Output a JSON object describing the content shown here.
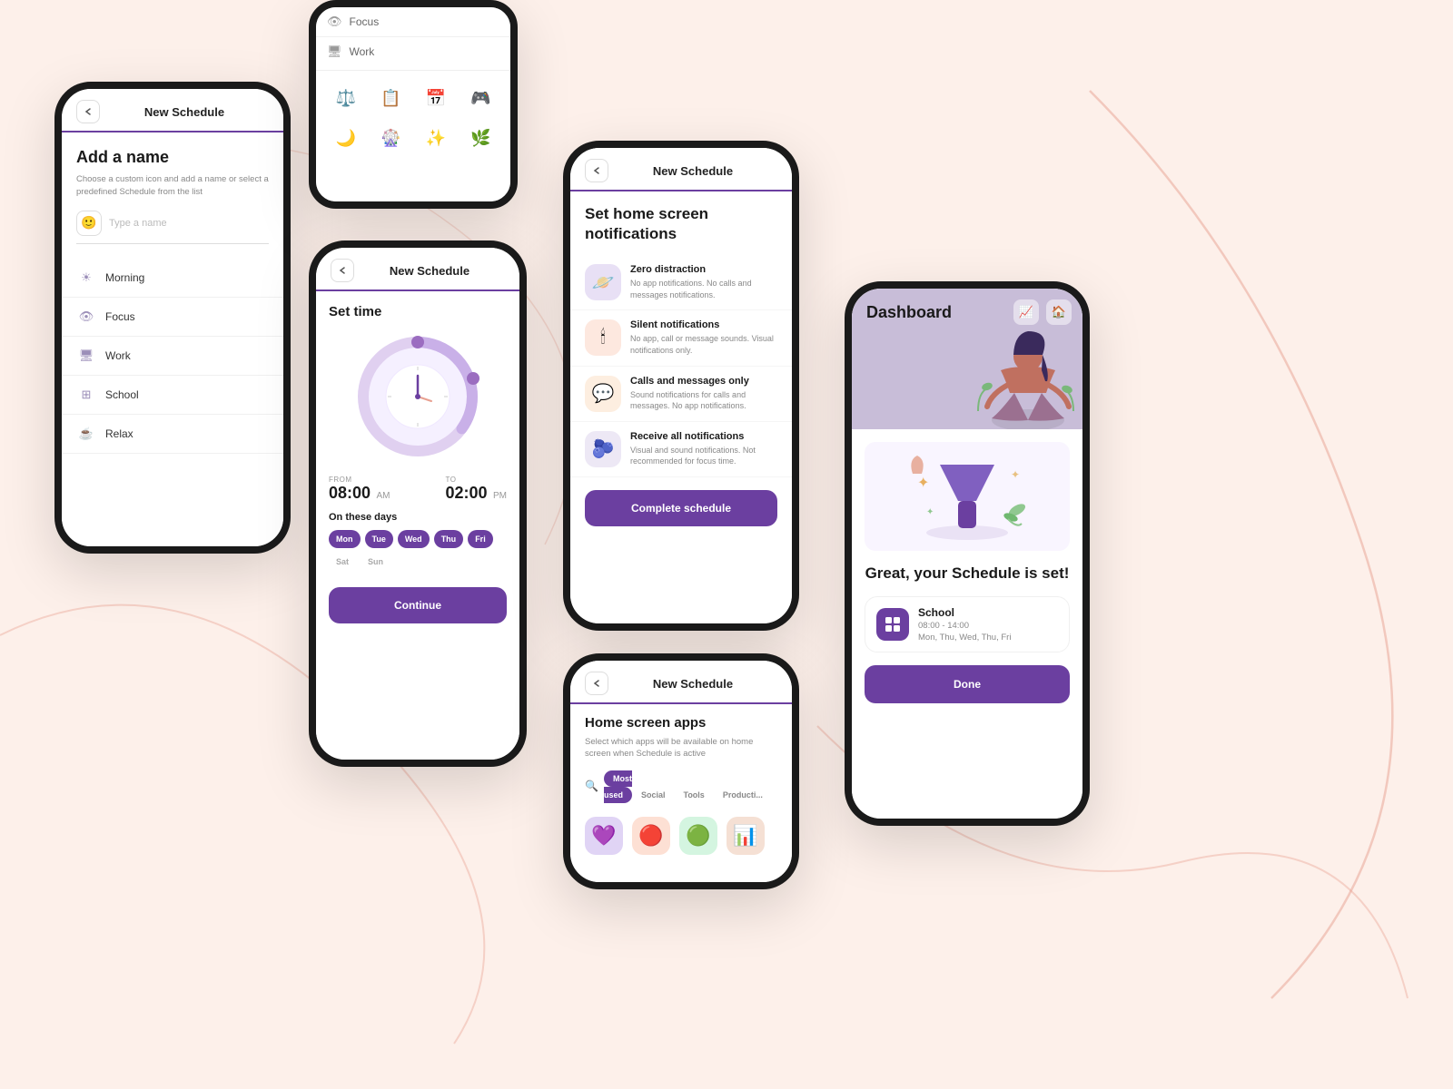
{
  "bg": {
    "color": "#fdf0ea"
  },
  "phone1": {
    "header": {
      "back": "‹",
      "title": "New Schedule"
    },
    "add_name": {
      "title": "Add a name",
      "subtitle": "Choose a custom icon and add a name or select a predefined Schedule from the list",
      "input_placeholder": "Type a name"
    },
    "list": [
      {
        "icon": "☀",
        "label": "Morning"
      },
      {
        "icon": "👁",
        "label": "Focus"
      },
      {
        "icon": "🖥",
        "label": "Work"
      },
      {
        "icon": "⊞",
        "label": "School"
      },
      {
        "icon": "☕",
        "label": "Relax"
      }
    ]
  },
  "phone2": {
    "items": [
      {
        "label": "Focus"
      },
      {
        "label": "Work"
      }
    ],
    "icons": [
      "⚖",
      "📋",
      "📅",
      "🎮",
      "🌙",
      "🎡",
      "✨",
      "🌿"
    ]
  },
  "phone3": {
    "header": {
      "title": "New Schedule"
    },
    "set_time": {
      "title": "Set time",
      "from_label": "FROM",
      "from_time": "08:00",
      "from_ampm": "AM",
      "to_label": "TO",
      "to_time": "02:00",
      "to_ampm": "PM"
    },
    "days": {
      "title": "On these days",
      "list": [
        {
          "label": "Mon",
          "active": true
        },
        {
          "label": "Tue",
          "active": true
        },
        {
          "label": "Wed",
          "active": true
        },
        {
          "label": "Thu",
          "active": true
        },
        {
          "label": "Fri",
          "active": true
        },
        {
          "label": "Sat",
          "active": false
        },
        {
          "label": "Sun",
          "active": false
        }
      ]
    },
    "continue_btn": "Continue"
  },
  "phone4": {
    "header": {
      "title": "New Schedule"
    },
    "title": "Set home screen notifications",
    "notifications": [
      {
        "title": "Zero distraction",
        "subtitle": "No app notifications. No calls and messages notifications.",
        "icon": "🪐",
        "color": "purple"
      },
      {
        "title": "Silent notifications",
        "subtitle": "No app, call or message sounds. Visual notifications only.",
        "icon": "🕯",
        "color": "peach"
      },
      {
        "title": "Calls and messages only",
        "subtitle": "Sound notifications for calls and messages. No app notifications.",
        "icon": "💬",
        "color": "orange"
      },
      {
        "title": "Receive all notifications",
        "subtitle": "Visual and sound notifications. Not recommended for focus time.",
        "icon": "🫐",
        "color": "lavender"
      }
    ],
    "complete_btn": "Complete schedule"
  },
  "phone5": {
    "header": {
      "title": "New Schedule"
    },
    "title": "Home screen apps",
    "subtitle": "Select which apps will be available on home screen when Schedule is active",
    "filters": [
      {
        "label": "Most used",
        "active": true
      },
      {
        "label": "Social",
        "active": false
      },
      {
        "label": "Tools",
        "active": false
      },
      {
        "label": "Producti...",
        "active": false
      }
    ]
  },
  "phone6": {
    "dashboard_title": "Dashboard",
    "great_text": "Great, your Schedule is set!",
    "schedule": {
      "icon": "⊞",
      "title": "School",
      "time": "08:00 - 14:00",
      "days": "Mon, Thu, Wed, Thu, Fri"
    },
    "done_btn": "Done"
  }
}
